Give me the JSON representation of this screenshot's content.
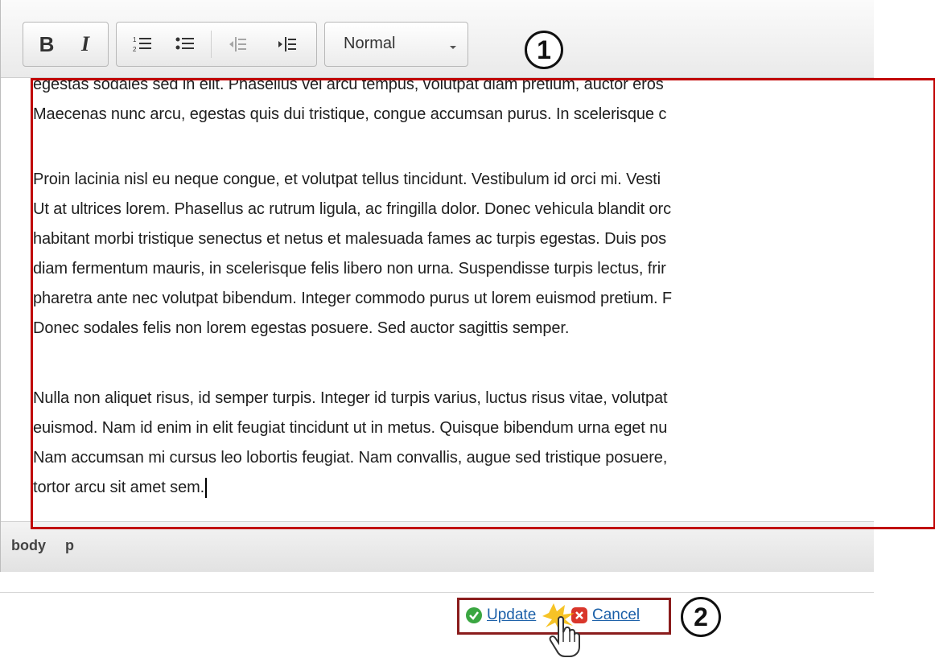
{
  "toolbar": {
    "bold_label": "B",
    "italic_label": "I",
    "format_value": "Normal",
    "callout": "1"
  },
  "content": {
    "lines_top": [
      "egestas sodales sed in elit. Phasellus vel arcu tempus, volutpat diam pretium, auctor eros",
      "Maecenas nunc arcu, egestas quis dui tristique, congue accumsan purus. In scelerisque c"
    ],
    "lines_mid": [
      "Proin lacinia nisl eu neque congue, et volutpat tellus tincidunt. Vestibulum id orci mi. Vesti",
      "Ut at ultrices lorem. Phasellus ac rutrum ligula, ac fringilla dolor. Donec vehicula blandit orc",
      "habitant morbi tristique senectus et netus et malesuada fames ac turpis egestas. Duis pos",
      "diam fermentum mauris, in scelerisque felis libero non urna. Suspendisse turpis lectus, frir",
      "pharetra ante nec volutpat bibendum. Integer commodo purus ut lorem euismod pretium. F",
      "Donec sodales felis non lorem egestas posuere. Sed auctor sagittis semper."
    ],
    "lines_bot": [
      "Nulla non aliquet risus, id semper turpis. Integer id turpis varius, luctus risus vitae, volutpat",
      "euismod. Nam id enim in elit feugiat tincidunt ut in metus. Quisque bibendum urna eget nu",
      "Nam accumsan mi cursus leo lobortis feugiat. Nam convallis, augue sed tristique posuere,",
      "tortor arcu sit amet sem."
    ]
  },
  "pathbar": {
    "crumb1": "body",
    "crumb2": "p"
  },
  "actions": {
    "update_label": "Update",
    "cancel_label": "Cancel",
    "callout": "2"
  },
  "colors": {
    "highlight_red": "#c00000",
    "link_blue": "#1a5fa8",
    "update_green": "#3aa641",
    "cancel_red": "#d9362b"
  }
}
